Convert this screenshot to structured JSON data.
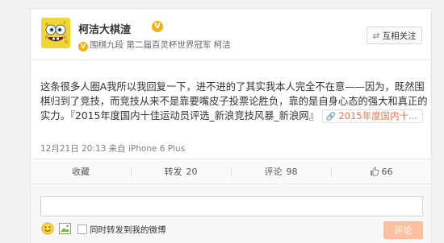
{
  "user": {
    "name": "柯洁大棋渣",
    "badge": "V",
    "verification": "围棋九段 第二届百灵杯世界冠军 柯洁"
  },
  "header": {
    "follow_label": "互相关注",
    "follow_icon": "swap-icon"
  },
  "post": {
    "lines": [
      "这条很多人圈A我所以我回复一下，进不进的了其实我本人完全不在意——因为，既然围",
      "棋归到了竞技，而竞技从来不是靠要嘴皮子投票论胜负，靠的是自身心态的强大和真正的",
      "实力。『2015年度国内十佳运动员评选_新浪竞技风暴_新浪网』"
    ],
    "link_label": "2015年度国内十...",
    "meta": "12月21日 20:13 来自 iPhone 6 Plus"
  },
  "actions": {
    "favorite": "收藏",
    "repost": "转发",
    "repost_count": "20",
    "comment": "评论",
    "comment_count": "98",
    "like_count": "66"
  },
  "comment_box": {
    "value": "",
    "placeholder": "",
    "repost_label": "同时转发到我的微博",
    "submit_label": "评论"
  },
  "colors": {
    "accent": "#eb7350",
    "submit_bg": "#ffc09f",
    "badge": "#f5b20a"
  }
}
